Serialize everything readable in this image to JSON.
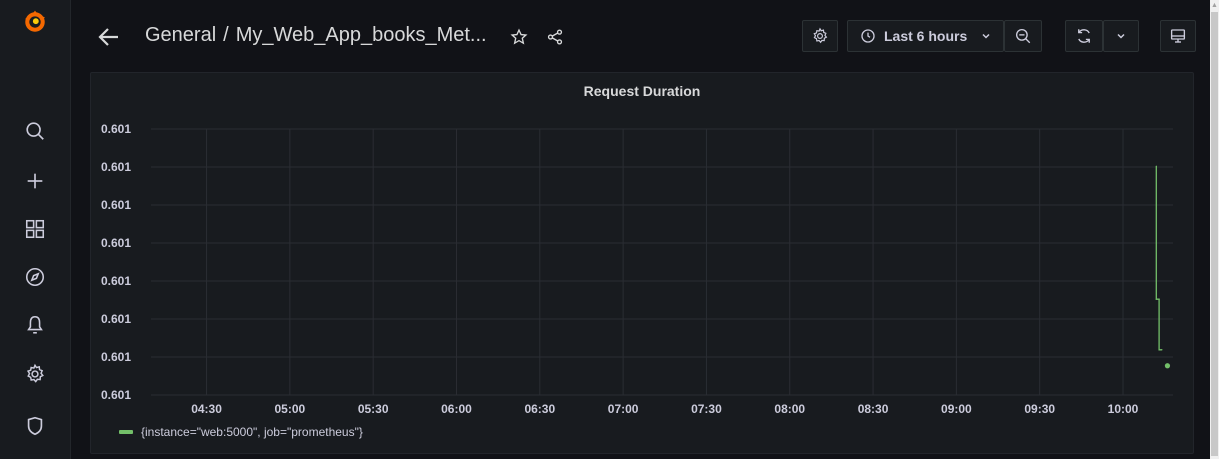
{
  "breadcrumb": {
    "folder": "General",
    "separator": "/",
    "dashboard": "My_Web_App_books_Met..."
  },
  "time_picker": {
    "label": "Last 6 hours"
  },
  "icons": {
    "sidebar": [
      "grafana-logo-icon",
      "search-icon",
      "plus-icon",
      "dashboards-grid-icon",
      "explore-compass-icon",
      "alerting-bell-icon",
      "gear-icon",
      "shield-icon"
    ],
    "toolbar": [
      "back-arrow-icon",
      "star-icon",
      "share-icon",
      "dashboard-settings-icon",
      "clock-icon",
      "chevron-down-icon",
      "zoom-out-icon",
      "refresh-icon",
      "tv-mode-icon"
    ]
  },
  "colors": {
    "background": "#111217",
    "panel": "#181b1f",
    "series": "#73bf69",
    "logo": "#f46800"
  },
  "panel": {
    "title": "Request Duration"
  },
  "chart_data": {
    "type": "line",
    "title": "Request Duration",
    "xlabel": "",
    "ylabel": "",
    "x_tick_labels": [
      "04:30",
      "05:00",
      "05:30",
      "06:00",
      "06:30",
      "07:00",
      "07:30",
      "08:00",
      "08:30",
      "09:00",
      "09:30",
      "10:00"
    ],
    "y_tick_labels": [
      "0.601",
      "0.601",
      "0.601",
      "0.601",
      "0.601",
      "0.601",
      "0.601",
      "0.601"
    ],
    "grid": true,
    "legend_position": "bottom-left",
    "series": [
      {
        "name": "{instance=\"web:5000\", job=\"prometheus\"}",
        "color": "#73bf69",
        "points": [
          {
            "x": "10:12",
            "level": 0.86
          },
          {
            "x": "10:12",
            "level": 0.36
          },
          {
            "x": "10:13",
            "level": 0.36
          },
          {
            "x": "10:13",
            "level": 0.17
          },
          {
            "x": "10:14",
            "level": 0.17
          }
        ],
        "last_point": {
          "x": "10:16",
          "level": 0.11
        }
      }
    ]
  }
}
